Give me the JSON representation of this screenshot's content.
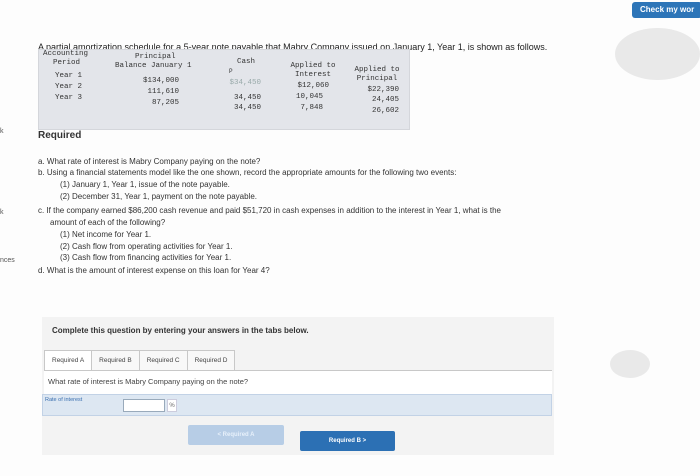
{
  "header": {
    "check_button": "Check my wor"
  },
  "edge_labels": {
    "e1": "k",
    "e2": "k",
    "e3": "nces"
  },
  "problem": {
    "intro": "A partial amortization schedule for a 5-year note payable that Mabry Company issued on January 1, Year 1, is shown as follows.",
    "schedule": {
      "headers": {
        "accounting_period": [
          "Accounting",
          "Period"
        ],
        "principal_balance": [
          "Principal",
          "Balance January 1"
        ],
        "cash": [
          "Cash",
          "P"
        ],
        "applied_interest": [
          "Applied to",
          "Interest"
        ],
        "applied_principal": [
          "Applied to",
          "Principal"
        ]
      },
      "rows": [
        {
          "period": "Year 1",
          "balance": "$134,000",
          "cash": "$34,450",
          "interest": "$12,060",
          "principal": "$22,390"
        },
        {
          "period": "Year 2",
          "balance": "111,610",
          "cash": "34,450",
          "interest": "10,045",
          "principal": "24,405"
        },
        {
          "period": "Year 3",
          "balance": "87,205",
          "cash": "34,450",
          "interest": "7,848",
          "principal": "26,602"
        }
      ]
    },
    "required_title": "Required",
    "questions": {
      "a": "a.  What rate of interest is Mabry Company paying on the note?",
      "b": "b.  Using a financial statements model like the one shown, record the appropriate amounts for the following two events:",
      "b1": "(1) January 1, Year 1, issue of the note payable.",
      "b2": "(2) December 31, Year 1, payment on the note payable.",
      "c": "c.  If the company earned $86,200 cash revenue and paid $51,720 in cash expenses in addition to the interest in Year 1, what is the",
      "c_cont": "amount of each of the following?",
      "c1": "(1) Net income for Year 1.",
      "c2": "(2) Cash flow from operating activities for Year 1.",
      "c3": "(3) Cash flow from financing activities for Year 1.",
      "d": "d.  What is the amount of interest expense on this loan for Year 4?"
    }
  },
  "answer_panel": {
    "instruction": "Complete this question by entering your answers in the tabs below.",
    "tabs": [
      {
        "label": "Required A",
        "active": true
      },
      {
        "label": "Required B",
        "active": false
      },
      {
        "label": "Required C",
        "active": false
      },
      {
        "label": "Required D",
        "active": false
      }
    ],
    "question": "What rate of interest is Mabry Company paying on the note?",
    "field_label": "Rate of interest",
    "field_value": "",
    "field_unit": "%",
    "prev_button": "< Required A",
    "next_button": "Required B  >"
  }
}
